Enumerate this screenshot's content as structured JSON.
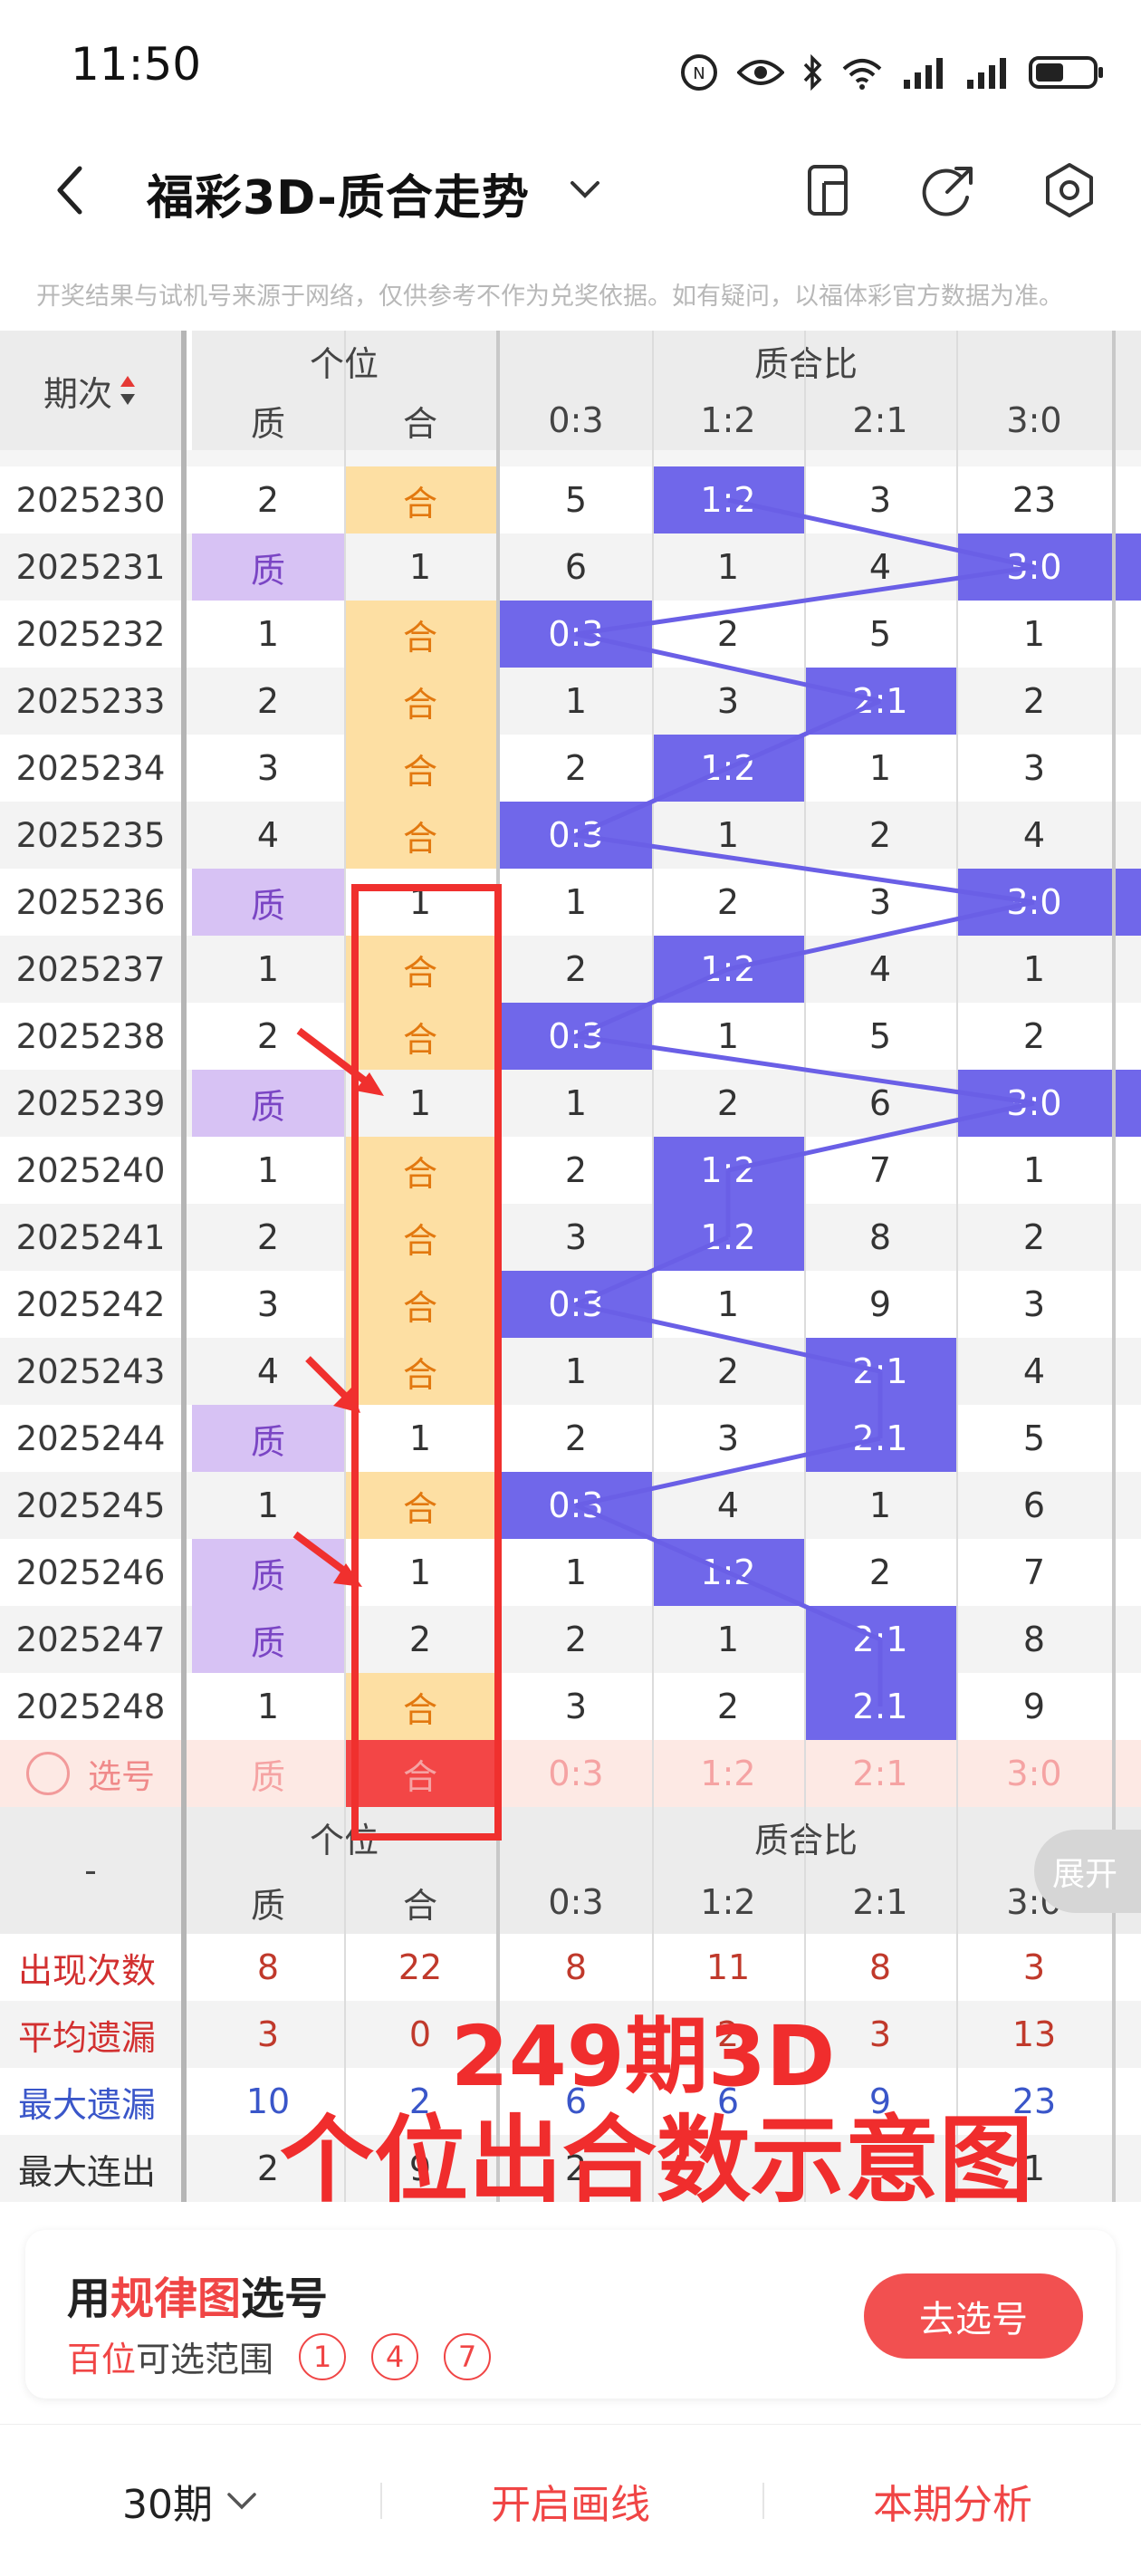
{
  "status_bar": {
    "time": "11:50",
    "battery_icon": "battery-icon"
  },
  "nav": {
    "title": "福彩3D-质合走势"
  },
  "notice": "开奖结果与试机号来源于网络，仅供参考不作为兑奖依据。如有疑问，以福体彩官方数据为准。",
  "table": {
    "issue_header": "期次",
    "group_position": "个位",
    "group_ratio": "质合比",
    "sub_headers": [
      "质",
      "合",
      "0:3",
      "1:2",
      "2:1",
      "3:0"
    ],
    "rows": [
      {
        "issue": "2025230",
        "zhi": "2",
        "he": "合",
        "r03": "5",
        "r12": "1:2",
        "r21": "3",
        "r30": "23"
      },
      {
        "issue": "2025231",
        "zhi": "质",
        "he": "1",
        "r03": "6",
        "r12": "1",
        "r21": "4",
        "r30": "3:0"
      },
      {
        "issue": "2025232",
        "zhi": "1",
        "he": "合",
        "r03": "0:3",
        "r12": "2",
        "r21": "5",
        "r30": "1"
      },
      {
        "issue": "2025233",
        "zhi": "2",
        "he": "合",
        "r03": "1",
        "r12": "3",
        "r21": "2:1",
        "r30": "2"
      },
      {
        "issue": "2025234",
        "zhi": "3",
        "he": "合",
        "r03": "2",
        "r12": "1:2",
        "r21": "1",
        "r30": "3"
      },
      {
        "issue": "2025235",
        "zhi": "4",
        "he": "合",
        "r03": "0:3",
        "r12": "1",
        "r21": "2",
        "r30": "4"
      },
      {
        "issue": "2025236",
        "zhi": "质",
        "he": "1",
        "r03": "1",
        "r12": "2",
        "r21": "3",
        "r30": "3:0"
      },
      {
        "issue": "2025237",
        "zhi": "1",
        "he": "合",
        "r03": "2",
        "r12": "1:2",
        "r21": "4",
        "r30": "1"
      },
      {
        "issue": "2025238",
        "zhi": "2",
        "he": "合",
        "r03": "0:3",
        "r12": "1",
        "r21": "5",
        "r30": "2"
      },
      {
        "issue": "2025239",
        "zhi": "质",
        "he": "1",
        "r03": "1",
        "r12": "2",
        "r21": "6",
        "r30": "3:0"
      },
      {
        "issue": "2025240",
        "zhi": "1",
        "he": "合",
        "r03": "2",
        "r12": "1:2",
        "r21": "7",
        "r30": "1"
      },
      {
        "issue": "2025241",
        "zhi": "2",
        "he": "合",
        "r03": "3",
        "r12": "1:2",
        "r21": "8",
        "r30": "2"
      },
      {
        "issue": "2025242",
        "zhi": "3",
        "he": "合",
        "r03": "0:3",
        "r12": "1",
        "r21": "9",
        "r30": "3"
      },
      {
        "issue": "2025243",
        "zhi": "4",
        "he": "合",
        "r03": "1",
        "r12": "2",
        "r21": "2:1",
        "r30": "4"
      },
      {
        "issue": "2025244",
        "zhi": "质",
        "he": "1",
        "r03": "2",
        "r12": "3",
        "r21": "2:1",
        "r30": "5"
      },
      {
        "issue": "2025245",
        "zhi": "1",
        "he": "合",
        "r03": "0:3",
        "r12": "4",
        "r21": "1",
        "r30": "6"
      },
      {
        "issue": "2025246",
        "zhi": "质",
        "he": "1",
        "r03": "1",
        "r12": "1:2",
        "r21": "2",
        "r30": "7"
      },
      {
        "issue": "2025247",
        "zhi": "质",
        "he": "2",
        "r03": "2",
        "r12": "1",
        "r21": "2:1",
        "r30": "8"
      },
      {
        "issue": "2025248",
        "zhi": "1",
        "he": "合",
        "r03": "3",
        "r12": "2",
        "r21": "2:1",
        "r30": "9"
      }
    ],
    "select_row": {
      "label": "选号",
      "values": [
        "质",
        "合",
        "0:3",
        "1:2",
        "2:1",
        "3:0"
      ]
    },
    "bottom_dash": "-",
    "stats": [
      {
        "label": "出现次数",
        "values": [
          "8",
          "22",
          "8",
          "11",
          "8",
          "3"
        ]
      },
      {
        "label": "平均遗漏",
        "values": [
          "3",
          "0",
          "",
          "2",
          "3",
          "13"
        ]
      },
      {
        "label": "最大遗漏",
        "values": [
          "10",
          "2",
          "6",
          "6",
          "9",
          "23"
        ]
      },
      {
        "label": "最大连出",
        "values": [
          "2",
          "9",
          "2",
          "",
          "",
          "1"
        ]
      }
    ]
  },
  "annotation": {
    "line1": "249期3D",
    "line2": "个位出合数示意图"
  },
  "expand_label": "展开",
  "card": {
    "prefix": "用",
    "highlight": "规律图",
    "suffix": "选号",
    "sub_highlight": "百位",
    "sub_text": "可选范围",
    "numbers": [
      "1",
      "4",
      "7"
    ],
    "button": "去选号"
  },
  "bottom_bar": {
    "periods": "30期",
    "draw_line": "开启画线",
    "analysis": "本期分析"
  },
  "colors": {
    "accent_red": "#f04545",
    "purple": "#7067ea",
    "zhi_bg": "#d7c2f4",
    "he_bg": "#fddfa3"
  }
}
